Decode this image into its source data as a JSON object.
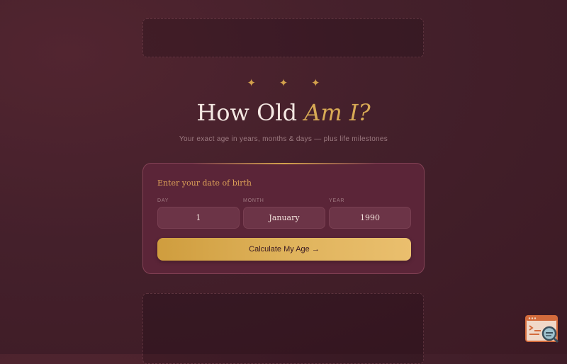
{
  "header": {
    "stars": "✦ ✦ ✦",
    "title_main": "How Old ",
    "title_accent": "Am I?",
    "subtitle": "Your exact age in years, months & days — plus life milestones"
  },
  "form": {
    "heading": "Enter your date of birth",
    "day_label": "DAY",
    "day_value": "1",
    "month_label": "MONTH",
    "month_value": "January",
    "year_label": "YEAR",
    "year_value": "1990",
    "submit_label": "Calculate My Age →"
  },
  "widget": {
    "icon": "code-search-icon"
  },
  "colors": {
    "accent": "#d4a24c",
    "background": "#44202b",
    "card": "#5b2538"
  }
}
